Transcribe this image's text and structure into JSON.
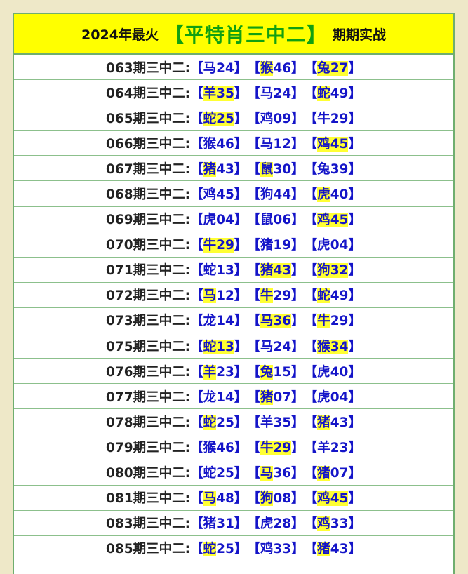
{
  "header": {
    "prefix": "2024年最火",
    "title": "【平特肖三中二】",
    "suffix": "期期实战"
  },
  "rows": [
    {
      "period": "063期三中二:",
      "picks": [
        {
          "z": "马",
          "n": "24",
          "hl": "none"
        },
        {
          "z": "猴",
          "n": "46",
          "hl": "zodiac"
        },
        {
          "z": "兔",
          "n": "27",
          "hl": "all"
        }
      ]
    },
    {
      "period": "064期三中二:",
      "picks": [
        {
          "z": "羊",
          "n": "35",
          "hl": "all"
        },
        {
          "z": "马",
          "n": "24",
          "hl": "none"
        },
        {
          "z": "蛇",
          "n": "49",
          "hl": "zodiac"
        }
      ]
    },
    {
      "period": "065期三中二:",
      "picks": [
        {
          "z": "蛇",
          "n": "25",
          "hl": "all"
        },
        {
          "z": "鸡",
          "n": "09",
          "hl": "none"
        },
        {
          "z": "牛",
          "n": "29",
          "hl": "none"
        }
      ]
    },
    {
      "period": "066期三中二:",
      "picks": [
        {
          "z": "猴",
          "n": "46",
          "hl": "none"
        },
        {
          "z": "马",
          "n": "12",
          "hl": "none"
        },
        {
          "z": "鸡",
          "n": "45",
          "hl": "all"
        }
      ]
    },
    {
      "period": "067期三中二:",
      "picks": [
        {
          "z": "猪",
          "n": "43",
          "hl": "zodiac"
        },
        {
          "z": "鼠",
          "n": "30",
          "hl": "zodiac"
        },
        {
          "z": "兔",
          "n": "39",
          "hl": "none"
        }
      ]
    },
    {
      "period": "068期三中二:",
      "picks": [
        {
          "z": "鸡",
          "n": "45",
          "hl": "none"
        },
        {
          "z": "狗",
          "n": "44",
          "hl": "none"
        },
        {
          "z": "虎",
          "n": "40",
          "hl": "zodiac"
        }
      ]
    },
    {
      "period": "069期三中二:",
      "picks": [
        {
          "z": "虎",
          "n": "04",
          "hl": "none"
        },
        {
          "z": "鼠",
          "n": "06",
          "hl": "none"
        },
        {
          "z": "鸡",
          "n": "45",
          "hl": "all"
        }
      ]
    },
    {
      "period": "070期三中二:",
      "picks": [
        {
          "z": "牛",
          "n": "29",
          "hl": "all"
        },
        {
          "z": "猪",
          "n": "19",
          "hl": "none"
        },
        {
          "z": "虎",
          "n": "04",
          "hl": "none"
        }
      ]
    },
    {
      "period": "071期三中二:",
      "picks": [
        {
          "z": "蛇",
          "n": "13",
          "hl": "none"
        },
        {
          "z": "猪",
          "n": "43",
          "hl": "all"
        },
        {
          "z": "狗",
          "n": "32",
          "hl": "all"
        }
      ]
    },
    {
      "period": "072期三中二:",
      "picks": [
        {
          "z": "马",
          "n": "12",
          "hl": "zodiac"
        },
        {
          "z": "牛",
          "n": "29",
          "hl": "zodiac"
        },
        {
          "z": "蛇",
          "n": "49",
          "hl": "zodiac"
        }
      ]
    },
    {
      "period": "073期三中二:",
      "picks": [
        {
          "z": "龙",
          "n": "14",
          "hl": "none"
        },
        {
          "z": "马",
          "n": "36",
          "hl": "all"
        },
        {
          "z": "牛",
          "n": "29",
          "hl": "zodiac"
        }
      ]
    },
    {
      "period": "075期三中二:",
      "picks": [
        {
          "z": "蛇",
          "n": "13",
          "hl": "all"
        },
        {
          "z": "马",
          "n": "24",
          "hl": "none"
        },
        {
          "z": "猴",
          "n": "34",
          "hl": "all"
        }
      ]
    },
    {
      "period": "076期三中二:",
      "picks": [
        {
          "z": "羊",
          "n": "23",
          "hl": "zodiac"
        },
        {
          "z": "兔",
          "n": "15",
          "hl": "zodiac"
        },
        {
          "z": "虎",
          "n": "40",
          "hl": "none"
        }
      ]
    },
    {
      "period": "077期三中二:",
      "picks": [
        {
          "z": "龙",
          "n": "14",
          "hl": "none"
        },
        {
          "z": "猪",
          "n": "07",
          "hl": "zodiac"
        },
        {
          "z": "虎",
          "n": "04",
          "hl": "none"
        }
      ]
    },
    {
      "period": "078期三中二:",
      "picks": [
        {
          "z": "蛇",
          "n": "25",
          "hl": "zodiac"
        },
        {
          "z": "羊",
          "n": "35",
          "hl": "none"
        },
        {
          "z": "猪",
          "n": "43",
          "hl": "zodiac"
        }
      ]
    },
    {
      "period": "079期三中二:",
      "picks": [
        {
          "z": "猴",
          "n": "46",
          "hl": "none"
        },
        {
          "z": "牛",
          "n": "29",
          "hl": "all"
        },
        {
          "z": "羊",
          "n": "23",
          "hl": "none"
        }
      ]
    },
    {
      "period": "080期三中二:",
      "picks": [
        {
          "z": "蛇",
          "n": "25",
          "hl": "none"
        },
        {
          "z": "马",
          "n": "36",
          "hl": "zodiac"
        },
        {
          "z": "猪",
          "n": "07",
          "hl": "zodiac"
        }
      ]
    },
    {
      "period": "081期三中二:",
      "picks": [
        {
          "z": "马",
          "n": "48",
          "hl": "zodiac"
        },
        {
          "z": "狗",
          "n": "08",
          "hl": "zodiac"
        },
        {
          "z": "鸡",
          "n": "45",
          "hl": "all"
        }
      ]
    },
    {
      "period": "083期三中二:",
      "picks": [
        {
          "z": "猪",
          "n": "31",
          "hl": "none"
        },
        {
          "z": "虎",
          "n": "28",
          "hl": "none"
        },
        {
          "z": "鸡",
          "n": "33",
          "hl": "zodiac"
        }
      ]
    },
    {
      "period": "085期三中二:",
      "picks": [
        {
          "z": "蛇",
          "n": "25",
          "hl": "zodiac"
        },
        {
          "z": "鸡",
          "n": "33",
          "hl": "none"
        },
        {
          "z": "猪",
          "n": "43",
          "hl": "zodiac"
        }
      ]
    }
  ],
  "colors": {
    "title_green": "#11a011",
    "header_bg": "#ffff00",
    "pick_blue": "#1414c8",
    "highlight": "#ffff33",
    "border": "#6fae6f"
  }
}
